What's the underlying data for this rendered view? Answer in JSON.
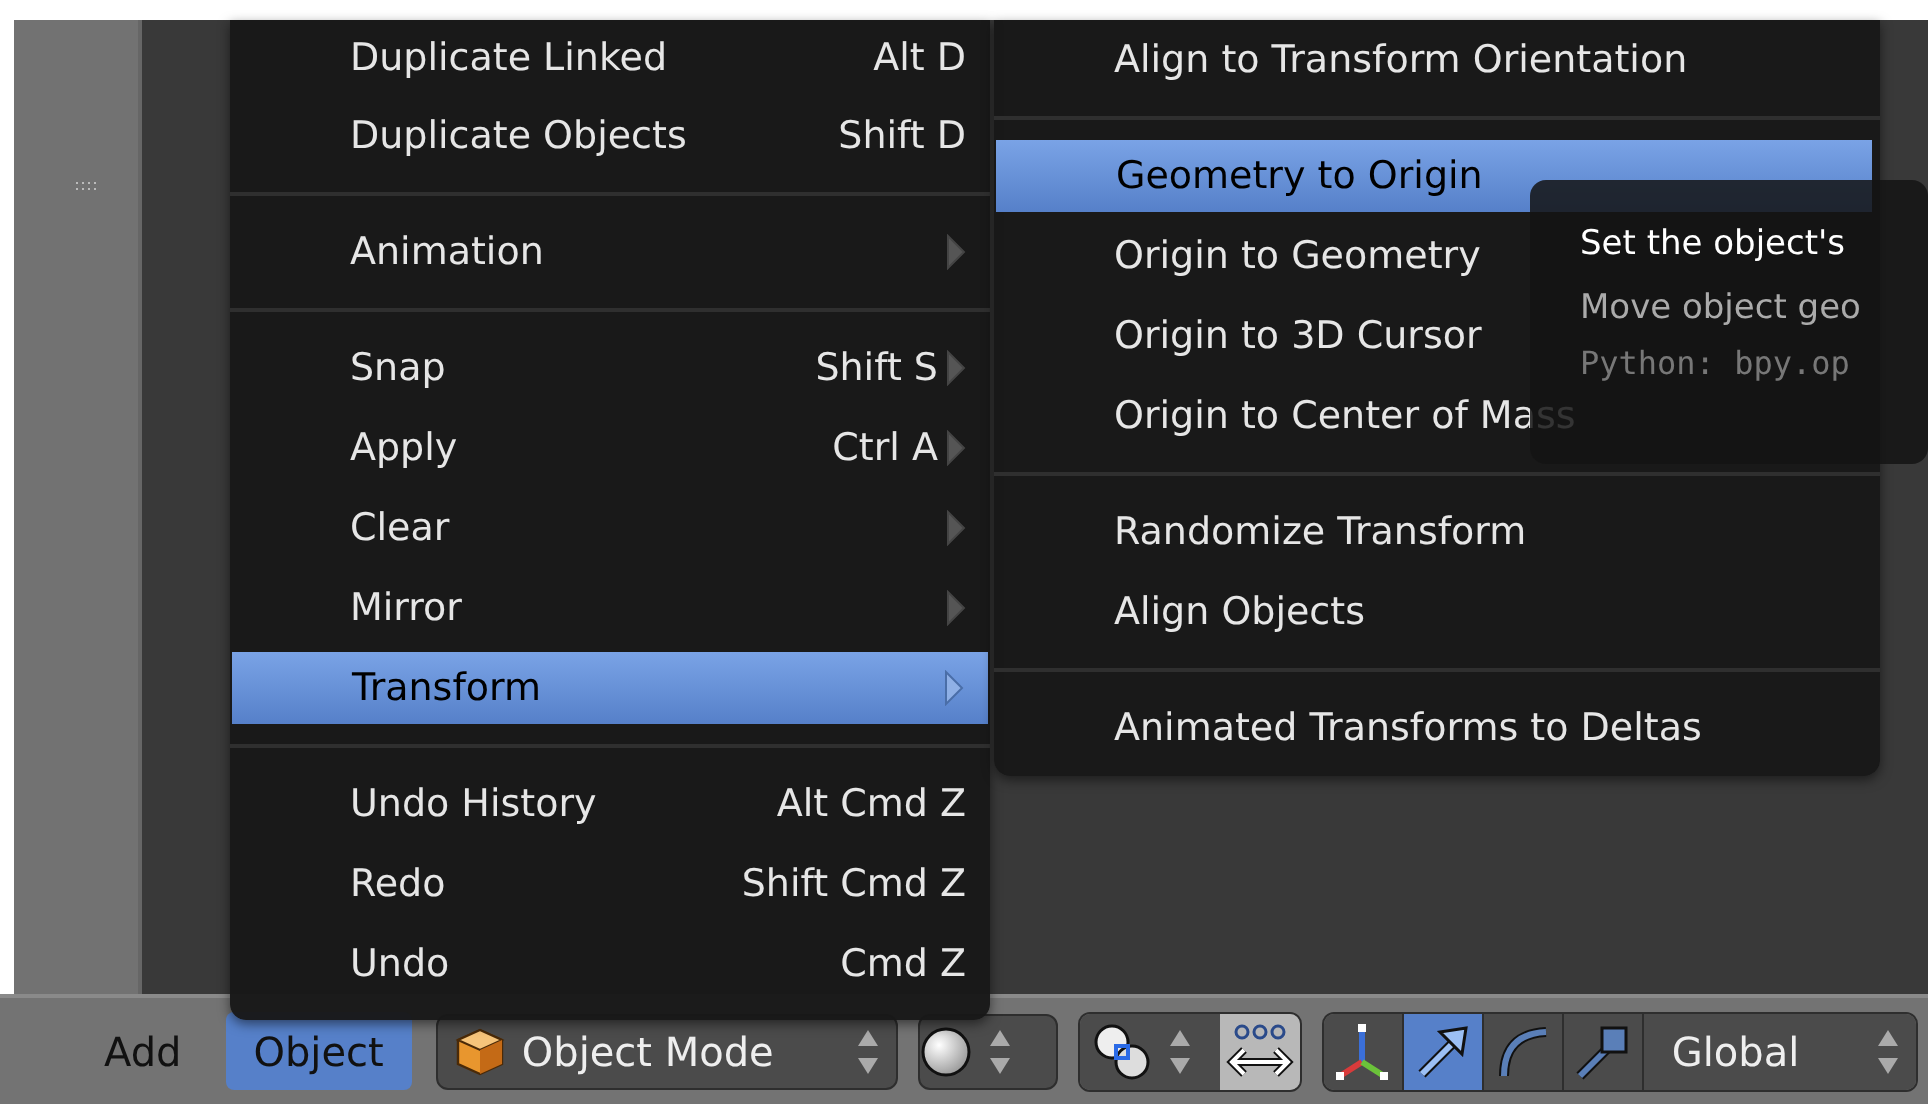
{
  "menu": {
    "items": [
      {
        "kind": "item",
        "label": "Duplicate Linked",
        "shortcut": "Alt D",
        "submenu": false,
        "selected": false
      },
      {
        "kind": "item",
        "label": "Duplicate Objects",
        "shortcut": "Shift D",
        "submenu": false,
        "selected": false
      },
      {
        "kind": "separator"
      },
      {
        "kind": "item",
        "label": "Animation",
        "submenu": true,
        "selected": false
      },
      {
        "kind": "separator"
      },
      {
        "kind": "item",
        "label": "Snap",
        "shortcut": "Shift S",
        "submenu": true,
        "selected": false
      },
      {
        "kind": "item",
        "label": "Apply",
        "shortcut": "Ctrl A",
        "submenu": true,
        "selected": false
      },
      {
        "kind": "item",
        "label": "Clear",
        "submenu": true,
        "selected": false
      },
      {
        "kind": "item",
        "label": "Mirror",
        "submenu": true,
        "selected": false
      },
      {
        "kind": "item",
        "label": "Transform",
        "submenu": true,
        "selected": true
      },
      {
        "kind": "separator"
      },
      {
        "kind": "item",
        "label": "Undo History",
        "shortcut": "Alt Cmd Z",
        "submenu": false,
        "selected": false
      },
      {
        "kind": "item",
        "label": "Redo",
        "shortcut": "Shift Cmd Z",
        "submenu": false,
        "selected": false
      },
      {
        "kind": "item",
        "label": "Undo",
        "shortcut": "Cmd Z",
        "submenu": false,
        "selected": false
      }
    ]
  },
  "submenu": {
    "items": [
      {
        "kind": "item",
        "label": "Align to Transform Orientation",
        "selected": false
      },
      {
        "kind": "separator"
      },
      {
        "kind": "item",
        "label": "Geometry to Origin",
        "selected": true
      },
      {
        "kind": "item",
        "label": "Origin to Geometry",
        "selected": false
      },
      {
        "kind": "item",
        "label": "Origin to 3D Cursor",
        "selected": false
      },
      {
        "kind": "item",
        "label": "Origin to Center of Mass",
        "selected": false
      },
      {
        "kind": "separator"
      },
      {
        "kind": "item",
        "label": "Randomize Transform",
        "selected": false
      },
      {
        "kind": "item",
        "label": "Align Objects",
        "selected": false
      },
      {
        "kind": "separator"
      },
      {
        "kind": "item",
        "label": "Animated Transforms to Deltas",
        "selected": false
      }
    ]
  },
  "tooltip": {
    "title": "Set the object's",
    "description": "Move object geo",
    "python": "Python: bpy.op"
  },
  "header": {
    "menus": [
      {
        "label": "Add",
        "selected": false
      },
      {
        "label": "Object",
        "selected": true
      }
    ],
    "mode": {
      "label": "Object Mode"
    },
    "align_toggle": {
      "on": true
    },
    "manipulators": [
      {
        "kind": "axes",
        "selected": false
      },
      {
        "kind": "translate",
        "selected": true
      },
      {
        "kind": "rotate",
        "selected": false
      },
      {
        "kind": "scale",
        "selected": false
      }
    ],
    "orientation": {
      "label": "Global"
    }
  }
}
